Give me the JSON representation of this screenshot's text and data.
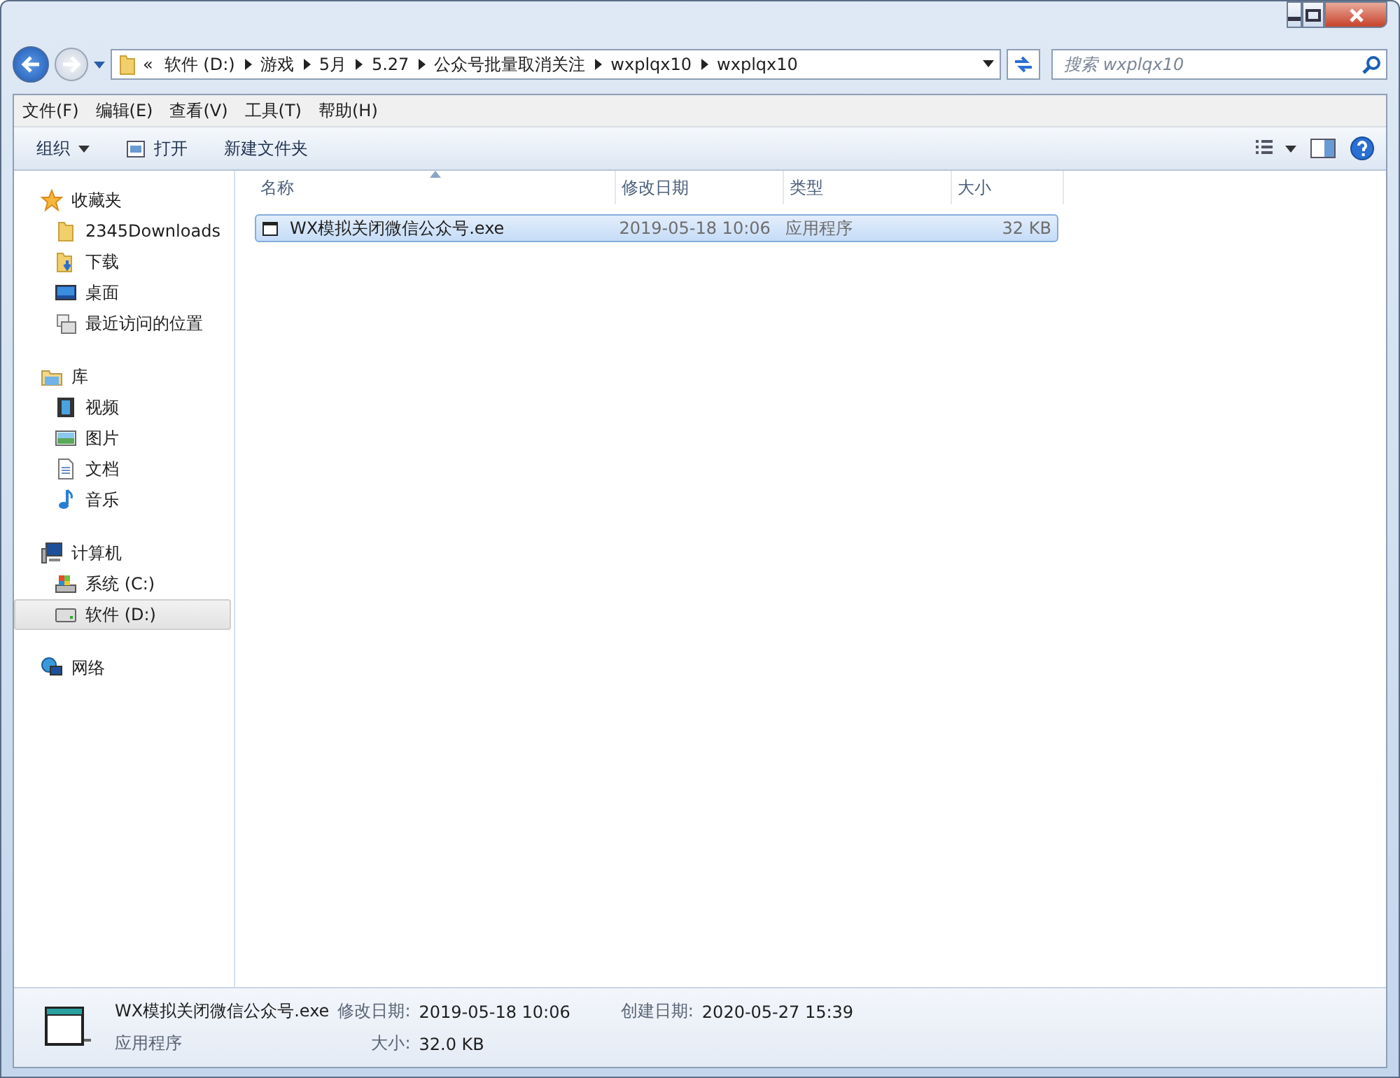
{
  "window": {
    "controls": [
      {
        "kind": "minimize"
      },
      {
        "kind": "maximize"
      },
      {
        "kind": "close"
      }
    ]
  },
  "address_bar": {
    "overflow": "«",
    "crumbs": [
      "软件 (D:)",
      "游戏",
      "5月",
      "5.27",
      "公众号批量取消关注",
      "wxplqx10",
      "wxplqx10"
    ]
  },
  "search": {
    "placeholder": "搜索 wxplqx10"
  },
  "menu_bar": [
    "文件(F)",
    "编辑(E)",
    "查看(V)",
    "工具(T)",
    "帮助(H)"
  ],
  "toolbar": [
    {
      "kind": "dropdown",
      "label": "组织"
    },
    {
      "kind": "open",
      "label": "打开"
    },
    {
      "kind": "plain",
      "label": "新建文件夹"
    }
  ],
  "sidebar": {
    "groups": [
      {
        "label": "收藏夹",
        "selected": false,
        "children": [
          {
            "label": "2345Downloads",
            "selected": false
          },
          {
            "label": "下载",
            "selected": false
          },
          {
            "label": "桌面",
            "selected": false
          },
          {
            "label": "最近访问的位置",
            "selected": false
          }
        ]
      },
      {
        "label": "库",
        "selected": false,
        "children": [
          {
            "label": "视频",
            "selected": false
          },
          {
            "label": "图片",
            "selected": false
          },
          {
            "label": "文档",
            "selected": false
          },
          {
            "label": "音乐",
            "selected": false
          }
        ]
      },
      {
        "label": "计算机",
        "selected": false,
        "children": [
          {
            "label": "系统 (C:)",
            "selected": false
          },
          {
            "label": "软件 (D:)",
            "selected": true
          }
        ]
      },
      {
        "label": "网络",
        "selected": false
      }
    ]
  },
  "table": {
    "columns": [
      {
        "label": "名称",
        "sorted": true
      },
      {
        "label": "修改日期",
        "sorted": false
      },
      {
        "label": "类型",
        "sorted": false
      },
      {
        "label": "大小",
        "sorted": false
      }
    ],
    "rows": [
      {
        "name": "WX模拟关闭微信公众号.exe",
        "modified": "2019-05-18 10:06",
        "type": "应用程序",
        "size": "32 KB",
        "selected": true
      }
    ]
  },
  "details": {
    "name": "WX模拟关闭微信公众号.exe",
    "type": "应用程序",
    "fields": [
      {
        "label": "修改日期:",
        "value": "2019-05-18 10:06"
      },
      {
        "label": "创建日期:",
        "value": "2020-05-27 15:39"
      },
      {
        "label": "大小:",
        "value": "32.0 KB"
      }
    ]
  }
}
